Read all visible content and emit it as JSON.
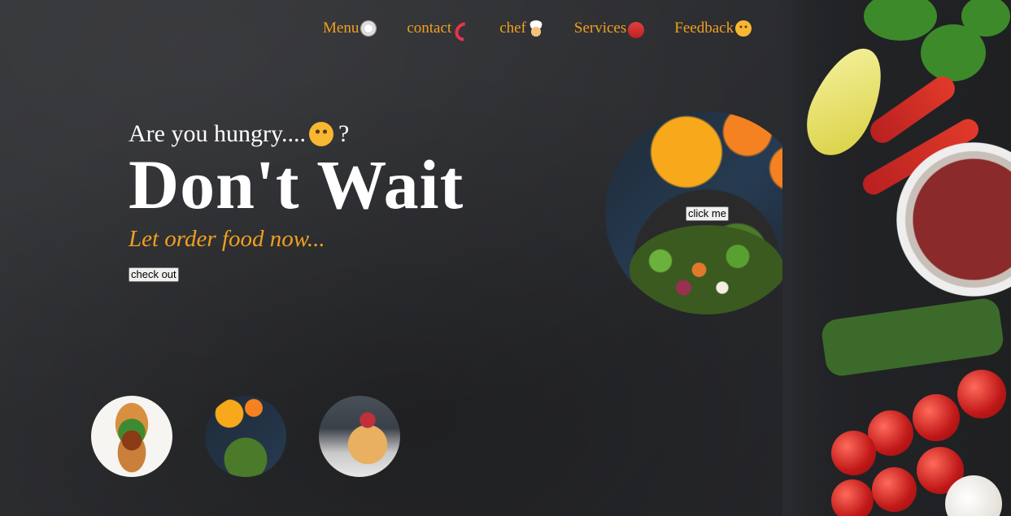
{
  "nav": {
    "items": [
      {
        "label": "Menu",
        "icon": "plate-icon"
      },
      {
        "label": "contact",
        "icon": "phone-icon"
      },
      {
        "label": "chef",
        "icon": "chef-icon"
      },
      {
        "label": "Services",
        "icon": "delivery-van-icon"
      },
      {
        "label": "Feedback",
        "icon": "smile-icon"
      }
    ]
  },
  "hero": {
    "question": "Are you hungry....",
    "question_suffix": "?",
    "headline": "Don't Wait",
    "tagline": "Let order food now...",
    "button_label": "check out"
  },
  "feature": {
    "button_label": "click me"
  },
  "colors": {
    "accent": "#f0a020",
    "background": "#2b2c2f",
    "text": "#ffffff"
  }
}
